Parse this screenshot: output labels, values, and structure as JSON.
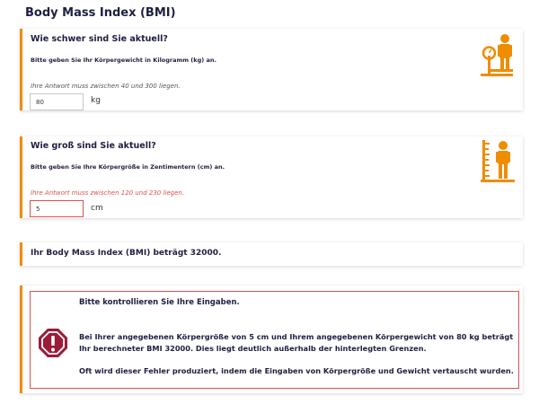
{
  "page": {
    "title": "Body Mass Index (BMI)"
  },
  "weight": {
    "question": "Wie schwer sind Sie aktuell?",
    "hint": "Bitte geben Sie Ihr Körpergewicht in Kilogramm (kg) an.",
    "range_note": "Ihre Antwort muss zwischen 40 und 300 liegen.",
    "value": "80",
    "unit": "kg",
    "icon": "scale-person-icon"
  },
  "height": {
    "question": "Wie groß sind Sie aktuell?",
    "hint": "Bitte geben Sie Ihre Körpergröße in Zentimentern (cm) an.",
    "range_note": "Ihre Antwort muss zwischen 120 und 230 liegen.",
    "value": "5",
    "unit": "cm",
    "icon": "height-measure-icon"
  },
  "result": {
    "text": "Ihr Body Mass Index (BMI) beträgt 32000."
  },
  "error": {
    "title": "Bitte kontrollieren Sie Ihre Eingaben.",
    "message": "Bei Ihrer angegebenen Körpergröße von 5 cm und Ihrem angegebenen Körpergewicht von 80 kg beträgt Ihr berechneter BMI 32000. Dies liegt deutlich außerhalb der hinterlegten Grenzen.",
    "note": "Oft wird dieser Fehler produziert, indem die Eingaben von Körpergröße und Gewicht vertauscht wurden.",
    "icon": "error-octagon-icon"
  },
  "colors": {
    "accent": "#f08c00",
    "error": "#d9534f",
    "error_icon": "#9b1c3a",
    "text": "#1e1e40"
  }
}
